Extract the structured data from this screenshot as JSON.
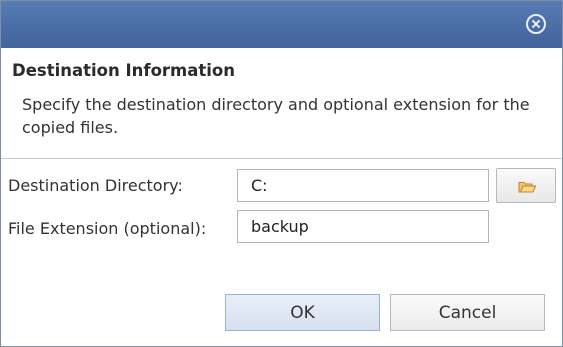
{
  "dialog": {
    "close_icon": "close-circle-icon",
    "header": {
      "title": "Destination Information",
      "description": "Specify the destination directory and optional extension for the copied files."
    },
    "fields": {
      "destination_directory": {
        "label": "Destination Directory:",
        "value": "C:",
        "browse_icon": "folder-open-icon"
      },
      "file_extension": {
        "label": "File Extension (optional):",
        "value": "backup"
      }
    },
    "buttons": {
      "ok": "OK",
      "cancel": "Cancel"
    }
  },
  "colors": {
    "titlebar": "#4a6ca6",
    "folder_icon": "#e8a33d"
  }
}
